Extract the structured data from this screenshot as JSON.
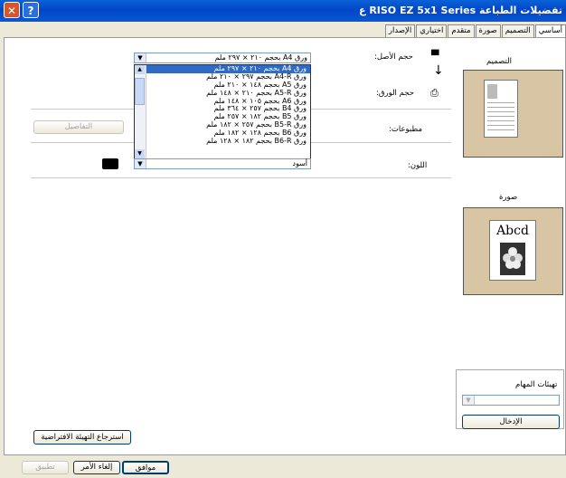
{
  "window": {
    "title": "تفضيلات الطباعة RISO EZ 5x1 Series ع",
    "close_glyph": "✕",
    "help_glyph": "?"
  },
  "tabs": [
    {
      "label": "أساسي",
      "active": true
    },
    {
      "label": "التصميم"
    },
    {
      "label": "صورة"
    },
    {
      "label": "متقدم"
    },
    {
      "label": "اختياري"
    },
    {
      "label": "الإصدار"
    }
  ],
  "layout_section": {
    "title": "التصميم"
  },
  "image_section": {
    "title": "صورة",
    "preview_text": "Abcd"
  },
  "fields": {
    "original_size_label": "حجم الأصل:",
    "paper_size_label": "حجم الورق:",
    "prints_label": "مطبوعات:",
    "color_label": "اللون:",
    "original_size_value": "ورق A4 بحجم ٢١٠ × ٢٩٧ ملم",
    "color_value": "أسود",
    "details_button": "التفاصيل"
  },
  "dropdown_options": [
    "ورق A4 بحجم ٢١٠ × ٢٩٧ ملم",
    "ورق A4-R بحجم ٢٩٧ × ٢١٠ ملم",
    "ورق A5 بحجم ١٤٨ × ٢١٠ ملم",
    "ورق A5-R بحجم ٢١٠ × ١٤٨ ملم",
    "ورق A6 بحجم ١٠٥ × ١٤٨ ملم",
    "ورق B4 بحجم ٢٥٧ × ٣٦٤ ملم",
    "ورق B5 بحجم ١٨٢ × ٢٥٧ ملم",
    "ورق B5-R بحجم ٢٥٧ × ١٨٢ ملم",
    "ورق B6 بحجم ١٢٨ × ١٨٢ ملم",
    "ورق B6-R بحجم ١٨٢ × ١٢٨ ملم"
  ],
  "selected_option_index": 0,
  "job_settings": {
    "title": "تهيئات المهام",
    "input_button": "الإدخال"
  },
  "restore_defaults_button": "استرجاع التهيئة الافتراضية",
  "footer": {
    "ok": "موافق",
    "cancel": "إلغاء الأمر",
    "apply": "تطبيق"
  },
  "colors": {
    "titlebar": "#0a58d6",
    "selection": "#316ac5",
    "preview_bg": "#d8c5a3"
  }
}
